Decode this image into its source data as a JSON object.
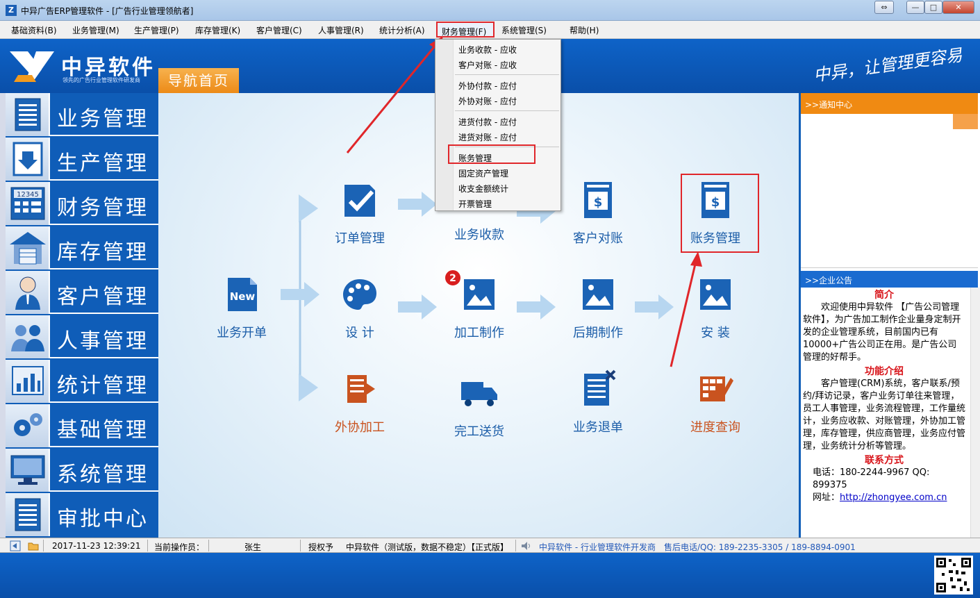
{
  "window": {
    "title": "中异广告ERP管理软件 - [广告行业管理领航者]",
    "buttons": {
      "restore": "⇔",
      "minimize": "—",
      "maximize": "□",
      "close": "✕"
    }
  },
  "menubar": {
    "items": [
      {
        "label": "基础资料(B)"
      },
      {
        "label": "业务管理(M)"
      },
      {
        "label": "生产管理(P)"
      },
      {
        "label": "库存管理(K)"
      },
      {
        "label": "客户管理(C)"
      },
      {
        "label": "人事管理(R)"
      },
      {
        "label": "统计分析(A)"
      },
      {
        "label": "财务管理(F)"
      },
      {
        "label": "系统管理(S)"
      },
      {
        "label": "帮助(H)"
      }
    ]
  },
  "banner": {
    "logo_text": "中异软件",
    "logo_sub": "领先的广告行业管理软件研发商",
    "nav_home": "导航首页",
    "slogan": "中异，让管理更容易"
  },
  "sidebar": {
    "items": [
      {
        "label": "业务管理",
        "icon": "document-icon"
      },
      {
        "label": "生产管理",
        "icon": "download-icon"
      },
      {
        "label": "财务管理",
        "icon": "calculator-icon",
        "icon_text": "12345"
      },
      {
        "label": "库存管理",
        "icon": "warehouse-icon"
      },
      {
        "label": "客户管理",
        "icon": "customer-icon"
      },
      {
        "label": "人事管理",
        "icon": "people-icon"
      },
      {
        "label": "统计管理",
        "icon": "chart-icon"
      },
      {
        "label": "基础管理",
        "icon": "gears-icon"
      },
      {
        "label": "系统管理",
        "icon": "monitor-icon"
      },
      {
        "label": "审批中心",
        "icon": "document-icon"
      }
    ]
  },
  "flow": {
    "start": {
      "label": "业务开单",
      "icon_text": "New"
    },
    "order": {
      "label": "订单管理"
    },
    "receipt": {
      "label": "业务收款"
    },
    "reconcile": {
      "label": "客户对账"
    },
    "accounts": {
      "label": "账务管理"
    },
    "design": {
      "label": "设  计"
    },
    "process": {
      "label": "加工制作"
    },
    "post": {
      "label": "后期制作"
    },
    "install": {
      "label": "安  装"
    },
    "outsource": {
      "label": "外协加工"
    },
    "delivery": {
      "label": "完工送货"
    },
    "return": {
      "label": "业务退单"
    },
    "progress": {
      "label": "进度查询"
    },
    "badge": "2"
  },
  "dropdown": {
    "items": [
      {
        "label": "业务收款  -  应收"
      },
      {
        "label": "客户对账  -  应收"
      },
      {
        "label": "外协付款  -  应付"
      },
      {
        "label": "外协对账  -  应付"
      },
      {
        "label": "进货付款  -  应付"
      },
      {
        "label": "进货对账  -  应付"
      },
      {
        "label": "账务管理"
      },
      {
        "label": "固定资产管理"
      },
      {
        "label": "收支金额统计"
      },
      {
        "label": "开票管理"
      }
    ]
  },
  "right_panel": {
    "notice_title": ">>通知中心",
    "announce_title": ">>企业公告",
    "intro_title": "简介",
    "intro_text": "欢迎使用中异软件 【广告公司管理软件】，为广告加工制作企业量身定制开发的企业管理系统，目前国内已有10000+广告公司正在用。是广告公司管理的好帮手。",
    "feature_title": "功能介绍",
    "feature_text": "客户管理(CRM)系统，客户联系/预约/拜访记录，客户业务订单往来管理，员工人事管理，业务流程管理，工作量统计，业务应收款、对账管理，外协加工管理，库存管理，供应商管理，业务应付管理，业务统计分析等管理。",
    "contact_title": "联系方式",
    "phone_line": "电话：180-2244-9967  QQ: 899375",
    "site_label": "网址：",
    "site_url": "http://zhongyee.com.cn"
  },
  "statusbar": {
    "datetime": "2017-11-23 12:39:21",
    "operator_label": "当前操作员：",
    "operator": "张生",
    "license_label": "授权予",
    "version": "中异软件（测试版，数据不稳定）【正式版】",
    "company": "中异软件 - 行业管理软件开发商",
    "hotline": "售后电话/QQ: 189-2235-3305  / 189-8894-0901"
  },
  "colors": {
    "brand_blue": "#0f5db8",
    "accent_orange": "#f08a12",
    "highlight_red": "#e0262a"
  }
}
